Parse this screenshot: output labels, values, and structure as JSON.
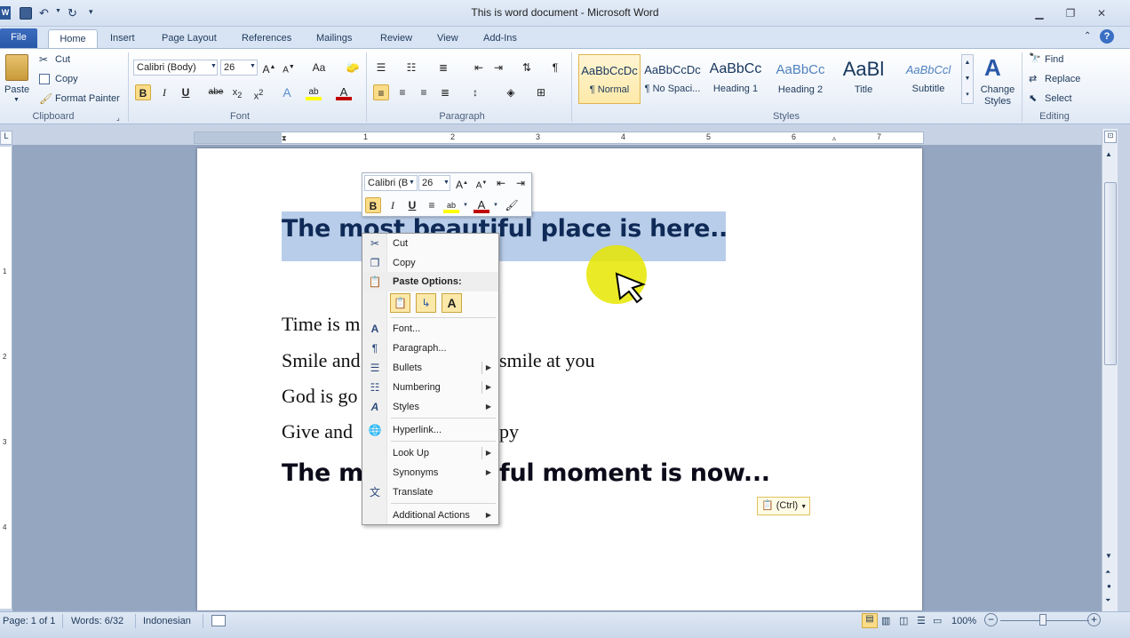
{
  "window": {
    "title": "This is word document  -  Microsoft Word"
  },
  "tabs": [
    "File",
    "Home",
    "Insert",
    "Page Layout",
    "References",
    "Mailings",
    "Review",
    "View",
    "Add-Ins"
  ],
  "clipboard": {
    "paste": "Paste",
    "cut": "Cut",
    "copy": "Copy",
    "format_painter": "Format Painter",
    "label": "Clipboard"
  },
  "font": {
    "name": "Calibri (Body)",
    "size": "26",
    "label": "Font",
    "font_color": "#c00000",
    "highlight_color": "#ffff00",
    "change_case": "Aa"
  },
  "paragraph": {
    "label": "Paragraph"
  },
  "styles": {
    "label": "Styles",
    "items": [
      {
        "sample": "AaBbCcDc",
        "name": "¶ Normal"
      },
      {
        "sample": "AaBbCcDc",
        "name": "¶ No Spaci..."
      },
      {
        "sample": "AaBbCc",
        "name": "Heading 1"
      },
      {
        "sample": "AaBbCc",
        "name": "Heading 2"
      },
      {
        "sample": "AaBl",
        "name": "Title"
      },
      {
        "sample": "AaBbCcl",
        "name": "Subtitle"
      }
    ],
    "change_styles": "Change Styles"
  },
  "editing": {
    "label": "Editing",
    "find": "Find",
    "replace": "Replace",
    "select": "Select"
  },
  "ruler": {
    "numbers": [
      "1",
      "1",
      "2",
      "3",
      "4",
      "5",
      "6",
      "7"
    ]
  },
  "vruler": {
    "numbers": [
      "1",
      "2",
      "3",
      "4"
    ]
  },
  "document": {
    "line1": "The most beautiful place is here..",
    "line2": "Time is m",
    "line3a": "Smile and",
    "line3b": "smile at you",
    "line4": "God is go",
    "line5a": "Give and",
    "line5b": "py",
    "line6a": "The m",
    "line6b": "ful moment is now...",
    "paste_ctrl": "(Ctrl)"
  },
  "mini_toolbar": {
    "font": "Calibri (B",
    "size": "26"
  },
  "context_menu": {
    "cut": "Cut",
    "copy": "Copy",
    "paste_options": "Paste Options:",
    "font": "Font...",
    "paragraph": "Paragraph...",
    "bullets": "Bullets",
    "numbering": "Numbering",
    "styles": "Styles",
    "hyperlink": "Hyperlink...",
    "look_up": "Look Up",
    "synonyms": "Synonyms",
    "translate": "Translate",
    "additional_actions": "Additional Actions"
  },
  "status": {
    "page": "Page: 1 of 1",
    "words": "Words: 6/32",
    "language": "Indonesian",
    "zoom": "100%"
  },
  "colors": {
    "selection": "#b8cde9",
    "cursor_highlight": "#e6e600",
    "accent": "#2a58a8"
  }
}
